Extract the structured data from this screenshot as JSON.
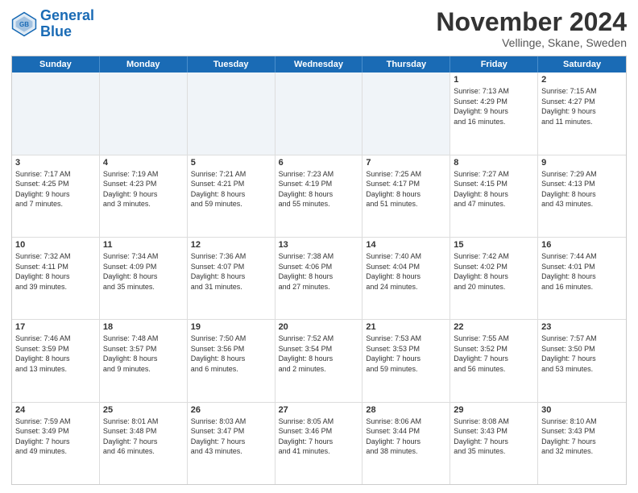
{
  "logo": {
    "line1": "General",
    "line2": "Blue"
  },
  "title": "November 2024",
  "subtitle": "Vellinge, Skane, Sweden",
  "header_days": [
    "Sunday",
    "Monday",
    "Tuesday",
    "Wednesday",
    "Thursday",
    "Friday",
    "Saturday"
  ],
  "rows": [
    [
      {
        "day": "",
        "info": "",
        "shaded": true
      },
      {
        "day": "",
        "info": "",
        "shaded": true
      },
      {
        "day": "",
        "info": "",
        "shaded": true
      },
      {
        "day": "",
        "info": "",
        "shaded": true
      },
      {
        "day": "",
        "info": "",
        "shaded": true
      },
      {
        "day": "1",
        "info": "Sunrise: 7:13 AM\nSunset: 4:29 PM\nDaylight: 9 hours\nand 16 minutes.",
        "shaded": false
      },
      {
        "day": "2",
        "info": "Sunrise: 7:15 AM\nSunset: 4:27 PM\nDaylight: 9 hours\nand 11 minutes.",
        "shaded": false
      }
    ],
    [
      {
        "day": "3",
        "info": "Sunrise: 7:17 AM\nSunset: 4:25 PM\nDaylight: 9 hours\nand 7 minutes.",
        "shaded": false
      },
      {
        "day": "4",
        "info": "Sunrise: 7:19 AM\nSunset: 4:23 PM\nDaylight: 9 hours\nand 3 minutes.",
        "shaded": false
      },
      {
        "day": "5",
        "info": "Sunrise: 7:21 AM\nSunset: 4:21 PM\nDaylight: 8 hours\nand 59 minutes.",
        "shaded": false
      },
      {
        "day": "6",
        "info": "Sunrise: 7:23 AM\nSunset: 4:19 PM\nDaylight: 8 hours\nand 55 minutes.",
        "shaded": false
      },
      {
        "day": "7",
        "info": "Sunrise: 7:25 AM\nSunset: 4:17 PM\nDaylight: 8 hours\nand 51 minutes.",
        "shaded": false
      },
      {
        "day": "8",
        "info": "Sunrise: 7:27 AM\nSunset: 4:15 PM\nDaylight: 8 hours\nand 47 minutes.",
        "shaded": false
      },
      {
        "day": "9",
        "info": "Sunrise: 7:29 AM\nSunset: 4:13 PM\nDaylight: 8 hours\nand 43 minutes.",
        "shaded": false
      }
    ],
    [
      {
        "day": "10",
        "info": "Sunrise: 7:32 AM\nSunset: 4:11 PM\nDaylight: 8 hours\nand 39 minutes.",
        "shaded": false
      },
      {
        "day": "11",
        "info": "Sunrise: 7:34 AM\nSunset: 4:09 PM\nDaylight: 8 hours\nand 35 minutes.",
        "shaded": false
      },
      {
        "day": "12",
        "info": "Sunrise: 7:36 AM\nSunset: 4:07 PM\nDaylight: 8 hours\nand 31 minutes.",
        "shaded": false
      },
      {
        "day": "13",
        "info": "Sunrise: 7:38 AM\nSunset: 4:06 PM\nDaylight: 8 hours\nand 27 minutes.",
        "shaded": false
      },
      {
        "day": "14",
        "info": "Sunrise: 7:40 AM\nSunset: 4:04 PM\nDaylight: 8 hours\nand 24 minutes.",
        "shaded": false
      },
      {
        "day": "15",
        "info": "Sunrise: 7:42 AM\nSunset: 4:02 PM\nDaylight: 8 hours\nand 20 minutes.",
        "shaded": false
      },
      {
        "day": "16",
        "info": "Sunrise: 7:44 AM\nSunset: 4:01 PM\nDaylight: 8 hours\nand 16 minutes.",
        "shaded": false
      }
    ],
    [
      {
        "day": "17",
        "info": "Sunrise: 7:46 AM\nSunset: 3:59 PM\nDaylight: 8 hours\nand 13 minutes.",
        "shaded": false
      },
      {
        "day": "18",
        "info": "Sunrise: 7:48 AM\nSunset: 3:57 PM\nDaylight: 8 hours\nand 9 minutes.",
        "shaded": false
      },
      {
        "day": "19",
        "info": "Sunrise: 7:50 AM\nSunset: 3:56 PM\nDaylight: 8 hours\nand 6 minutes.",
        "shaded": false
      },
      {
        "day": "20",
        "info": "Sunrise: 7:52 AM\nSunset: 3:54 PM\nDaylight: 8 hours\nand 2 minutes.",
        "shaded": false
      },
      {
        "day": "21",
        "info": "Sunrise: 7:53 AM\nSunset: 3:53 PM\nDaylight: 7 hours\nand 59 minutes.",
        "shaded": false
      },
      {
        "day": "22",
        "info": "Sunrise: 7:55 AM\nSunset: 3:52 PM\nDaylight: 7 hours\nand 56 minutes.",
        "shaded": false
      },
      {
        "day": "23",
        "info": "Sunrise: 7:57 AM\nSunset: 3:50 PM\nDaylight: 7 hours\nand 53 minutes.",
        "shaded": false
      }
    ],
    [
      {
        "day": "24",
        "info": "Sunrise: 7:59 AM\nSunset: 3:49 PM\nDaylight: 7 hours\nand 49 minutes.",
        "shaded": false
      },
      {
        "day": "25",
        "info": "Sunrise: 8:01 AM\nSunset: 3:48 PM\nDaylight: 7 hours\nand 46 minutes.",
        "shaded": false
      },
      {
        "day": "26",
        "info": "Sunrise: 8:03 AM\nSunset: 3:47 PM\nDaylight: 7 hours\nand 43 minutes.",
        "shaded": false
      },
      {
        "day": "27",
        "info": "Sunrise: 8:05 AM\nSunset: 3:46 PM\nDaylight: 7 hours\nand 41 minutes.",
        "shaded": false
      },
      {
        "day": "28",
        "info": "Sunrise: 8:06 AM\nSunset: 3:44 PM\nDaylight: 7 hours\nand 38 minutes.",
        "shaded": false
      },
      {
        "day": "29",
        "info": "Sunrise: 8:08 AM\nSunset: 3:43 PM\nDaylight: 7 hours\nand 35 minutes.",
        "shaded": false
      },
      {
        "day": "30",
        "info": "Sunrise: 8:10 AM\nSunset: 3:43 PM\nDaylight: 7 hours\nand 32 minutes.",
        "shaded": false
      }
    ]
  ]
}
